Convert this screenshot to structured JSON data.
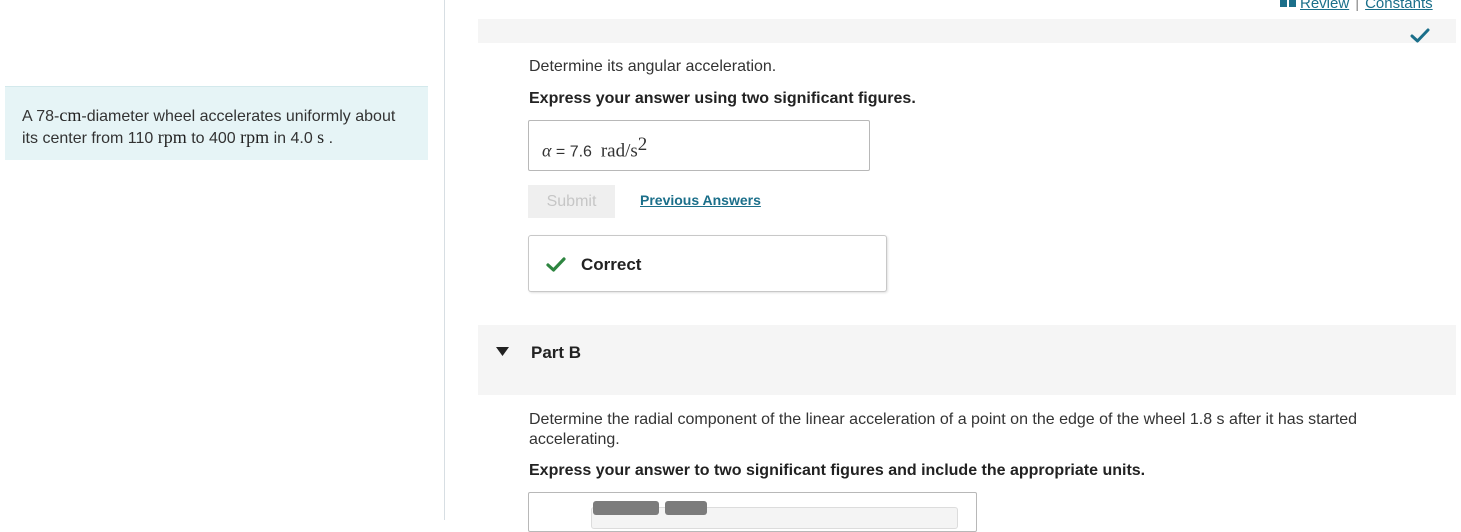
{
  "problem": {
    "t1": "A 78-",
    "m1": "cm",
    "t2": "-diameter wheel accelerates uniformly about its center from 110 ",
    "m2": "rpm",
    "t3": " to 400 ",
    "m3": "rpm",
    "t4": " in 4.0 ",
    "m4": "s",
    "t5": " ."
  },
  "links": {
    "review": "Review",
    "separator": "|",
    "constants": "Constants"
  },
  "partA": {
    "question": "Determine its angular acceleration.",
    "instruction": "Express your answer using two significant figures.",
    "answer_symbol": "α",
    "answer_equals": " = ",
    "answer_value": "7.6",
    "answer_unit": "rad/s",
    "answer_unit_exp": "2",
    "submit_label": "Submit",
    "previous_answers_label": "Previous Answers",
    "feedback": "Correct"
  },
  "partB": {
    "title": "Part B",
    "question": "Determine the radial component of the linear acceleration of a point on the edge of the wheel 1.8 s after it has started accelerating.",
    "instruction": "Express your answer to two significant figures and include the appropriate units."
  },
  "colors": {
    "accent_link": "#1b6f8a",
    "check_green": "#2e8540",
    "check_teal": "#1b6f8a",
    "problem_bg": "#e6f4f6"
  },
  "icons": {
    "book": "book-icon",
    "check_top": "checkmark-icon",
    "check_correct": "checkmark-icon",
    "caret": "caret-down-icon"
  }
}
